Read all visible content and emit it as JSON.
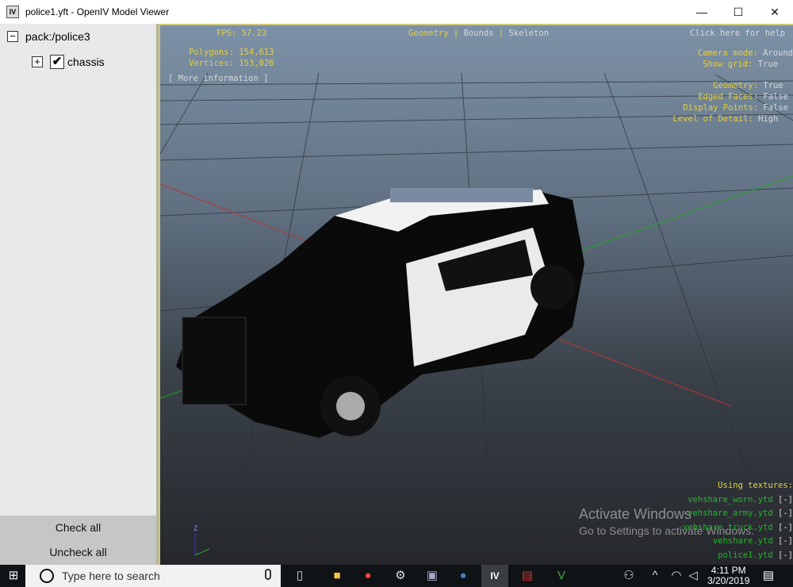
{
  "window": {
    "title": "police1.yft - OpenIV Model Viewer",
    "app_icon": "IV",
    "minimize": "—",
    "maximize": "☐",
    "close": "✕"
  },
  "tree": {
    "root": "pack:/police3",
    "root_toggle": "⊟",
    "child": "chassis",
    "child_toggle": "+",
    "child_checked": "✔"
  },
  "buttons": {
    "check_all": "Check all",
    "uncheck_all": "Uncheck all"
  },
  "hud": {
    "fps": "FPS: 57.23",
    "polygons_label": "Polygons:",
    "polygons": "154,613",
    "vertices_label": "Vertices:",
    "vertices": "153,020",
    "more_info": "[ More information ]",
    "modes": [
      "Geometry",
      "Bounds",
      "Skeleton"
    ],
    "sep": "|",
    "help": "Click here for help",
    "camera_label": "Camera mode:",
    "camera": "Around",
    "grid_label": "Show grid:",
    "grid": "True",
    "geometry_label": "Geometry:",
    "geometry": "True",
    "edged_label": "Edged Faces:",
    "edged": "False",
    "points_label": "Display Points:",
    "points": "False",
    "lod_label": "Level of Detail:",
    "lod": "High",
    "textures_label": "Using textures:",
    "textures": [
      "vehshare_worn.ytd",
      "vehshare_army.ytd",
      "vehshare_truck.ytd",
      "vehshare.ytd",
      "police1.ytd"
    ],
    "texture_toggle": "[-]",
    "axis_z": "Z"
  },
  "watermark": {
    "line1": "Activate Windows",
    "line2": "Go to Settings to activate Windows."
  },
  "taskbar": {
    "search_placeholder": "Type here to search",
    "time": "4:11 PM",
    "date": "3/20/2019"
  }
}
